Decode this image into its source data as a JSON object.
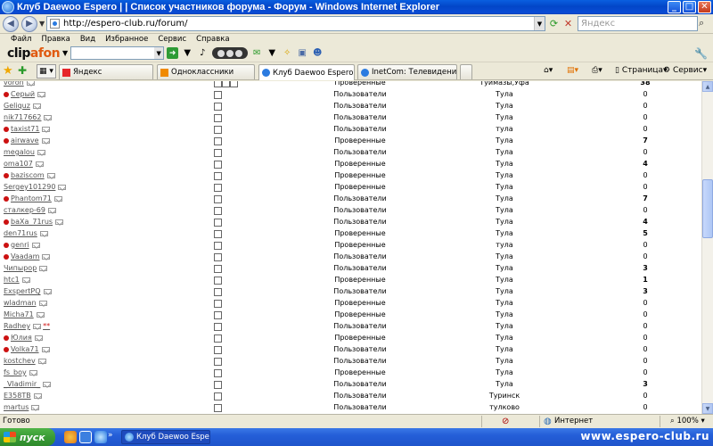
{
  "window": {
    "title": "Клуб Daewoo Espero | | Список участников форума - Форум - Windows Internet Explorer"
  },
  "address": {
    "url": "http://espero-club.ru/forum/",
    "search_placeholder": "Яндекс"
  },
  "menu": [
    "Файл",
    "Правка",
    "Вид",
    "Избранное",
    "Сервис",
    "Справка"
  ],
  "clipafon": {
    "logo_left": "clip",
    "logo_right": "afon"
  },
  "tabs": [
    {
      "label": "Яндекс"
    },
    {
      "label": "Одноклассники"
    },
    {
      "label": "Клуб Daewoo Espero||C..."
    },
    {
      "label": "InetCom: Телевидение и Ра..."
    }
  ],
  "commands": {
    "page": "Страница",
    "service": "Сервис"
  },
  "members": [
    {
      "name": "voron",
      "group": "Проверенные",
      "city": "Туймазы,Уфа",
      "posts": "38",
      "bold": true,
      "online": false,
      "checks": 3
    },
    {
      "name": "Серый",
      "group": "Пользователи",
      "city": "Тула",
      "posts": "0",
      "bold": false,
      "online": true,
      "checks": 1
    },
    {
      "name": "Geliquz",
      "group": "Пользователи",
      "city": "Тула",
      "posts": "0",
      "bold": false,
      "online": false,
      "checks": 1
    },
    {
      "name": "nik717662",
      "group": "Пользователи",
      "city": "Тула",
      "posts": "0",
      "bold": false,
      "online": false,
      "checks": 1
    },
    {
      "name": "taxist71",
      "group": "Пользователи",
      "city": "тула",
      "posts": "0",
      "bold": false,
      "online": true,
      "checks": 1
    },
    {
      "name": "airwave",
      "group": "Проверенные",
      "city": "Тула",
      "posts": "7",
      "bold": true,
      "online": true,
      "checks": 1
    },
    {
      "name": "megalou",
      "group": "Пользователи",
      "city": "Тула",
      "posts": "0",
      "bold": false,
      "online": false,
      "checks": 1
    },
    {
      "name": "oma107",
      "group": "Проверенные",
      "city": "Тула",
      "posts": "4",
      "bold": true,
      "online": false,
      "checks": 1
    },
    {
      "name": "baziscom",
      "group": "Проверенные",
      "city": "Тула",
      "posts": "0",
      "bold": false,
      "online": true,
      "checks": 1
    },
    {
      "name": "Sergey101290",
      "group": "Проверенные",
      "city": "Тула",
      "posts": "0",
      "bold": false,
      "online": false,
      "checks": 1
    },
    {
      "name": "Phantom71",
      "group": "Пользователи",
      "city": "Тула",
      "posts": "7",
      "bold": true,
      "online": true,
      "checks": 1
    },
    {
      "name": "сталкер-69",
      "group": "Пользователи",
      "city": "Тула",
      "posts": "0",
      "bold": false,
      "online": false,
      "checks": 1
    },
    {
      "name": "baXa_71rus",
      "group": "Пользователи",
      "city": "Тула",
      "posts": "4",
      "bold": true,
      "online": true,
      "checks": 1
    },
    {
      "name": "den71rus",
      "group": "Проверенные",
      "city": "Тула",
      "posts": "5",
      "bold": true,
      "online": false,
      "checks": 1
    },
    {
      "name": "genri",
      "group": "Проверенные",
      "city": "тула",
      "posts": "0",
      "bold": false,
      "online": true,
      "checks": 1
    },
    {
      "name": "Vaadam",
      "group": "Пользователи",
      "city": "Тула",
      "posts": "0",
      "bold": false,
      "online": true,
      "checks": 1
    },
    {
      "name": "Чипырор",
      "group": "Пользователи",
      "city": "Тула",
      "posts": "3",
      "bold": true,
      "online": false,
      "checks": 1
    },
    {
      "name": "htc1",
      "group": "Проверенные",
      "city": "Тула",
      "posts": "1",
      "bold": true,
      "online": false,
      "checks": 1
    },
    {
      "name": "ExspertPQ",
      "group": "Пользователи",
      "city": "Тула",
      "posts": "3",
      "bold": true,
      "online": false,
      "checks": 1
    },
    {
      "name": "wladman",
      "group": "Проверенные",
      "city": "Тула",
      "posts": "0",
      "bold": false,
      "online": false,
      "checks": 1
    },
    {
      "name": "Micha71",
      "group": "Проверенные",
      "city": "Тула",
      "posts": "0",
      "bold": false,
      "online": false,
      "checks": 1
    },
    {
      "name": "Radhey",
      "group": "Пользователи",
      "city": "Тула",
      "posts": "0",
      "bold": false,
      "online": false,
      "checks": 1,
      "stars": "**"
    },
    {
      "name": "Юлия",
      "group": "Проверенные",
      "city": "Тула",
      "posts": "0",
      "bold": false,
      "online": true,
      "checks": 1
    },
    {
      "name": "Volka71",
      "group": "Пользователи",
      "city": "Тула",
      "posts": "0",
      "bold": false,
      "online": true,
      "checks": 1
    },
    {
      "name": "kostchev",
      "group": "Пользователи",
      "city": "Тула",
      "posts": "0",
      "bold": false,
      "online": false,
      "checks": 1
    },
    {
      "name": "fs_boy",
      "group": "Проверенные",
      "city": "Тула",
      "posts": "0",
      "bold": false,
      "online": false,
      "checks": 1
    },
    {
      "name": "_Vladimir_",
      "group": "Пользователи",
      "city": "Тула",
      "posts": "3",
      "bold": true,
      "online": false,
      "checks": 1
    },
    {
      "name": "E358TB",
      "group": "Пользователи",
      "city": "Туринск",
      "posts": "0",
      "bold": false,
      "online": false,
      "checks": 1
    },
    {
      "name": "martus",
      "group": "Пользователи",
      "city": "тулково",
      "posts": "0",
      "bold": false,
      "online": false,
      "checks": 1
    }
  ],
  "status": {
    "text": "Готово",
    "zone": "Интернет",
    "zoom": "100%"
  },
  "taskbar": {
    "start": "пуск",
    "task": "Клуб Daewoo Espero...",
    "watermark": "www.espero-club.ru"
  },
  "colors": {
    "titlebar": "#0a4cd6",
    "online_dot": "#cc1111",
    "taskbar": "#245ed8",
    "start": "#3a9b36"
  },
  "icons": {
    "back": "back-arrow-icon",
    "forward": "forward-arrow-icon",
    "refresh": "refresh-icon",
    "stop": "stop-icon",
    "favorites": "star-icon",
    "add_favorite": "add-favorite-icon",
    "print": "printer-icon",
    "home": "home-icon",
    "rss": "rss-icon",
    "page": "page-icon",
    "settings": "wrench-icon",
    "globe": "globe-icon"
  }
}
